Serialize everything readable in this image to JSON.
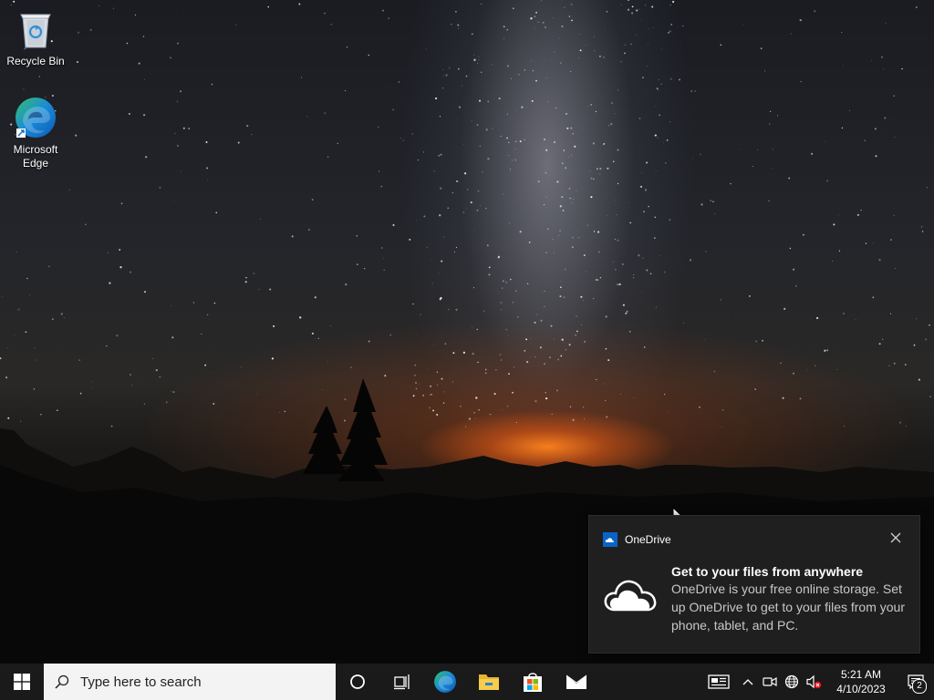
{
  "desktop": {
    "icons": [
      {
        "label": "Recycle Bin"
      },
      {
        "label": "Microsoft Edge"
      }
    ]
  },
  "toast": {
    "app_name": "OneDrive",
    "title": "Get to your files from anywhere",
    "body": "OneDrive is your free online storage. Set up OneDrive to get to your files from your phone, tablet, and PC."
  },
  "taskbar": {
    "search": {
      "placeholder": "Type here to search"
    },
    "pinned": [
      "cortana-icon",
      "task-view-icon",
      "edge-icon",
      "file-explorer-icon",
      "store-icon",
      "mail-icon"
    ],
    "clock": {
      "time": "5:21 AM",
      "date": "4/10/2023"
    },
    "notification_count": "2"
  },
  "colors": {
    "taskbar": "#1a1a1a",
    "toast_bg": "#1f1f1f",
    "onedrive_blue": "#0a64c8",
    "edge_blue": "#1a8ad8",
    "edge_green": "#35c06a"
  }
}
